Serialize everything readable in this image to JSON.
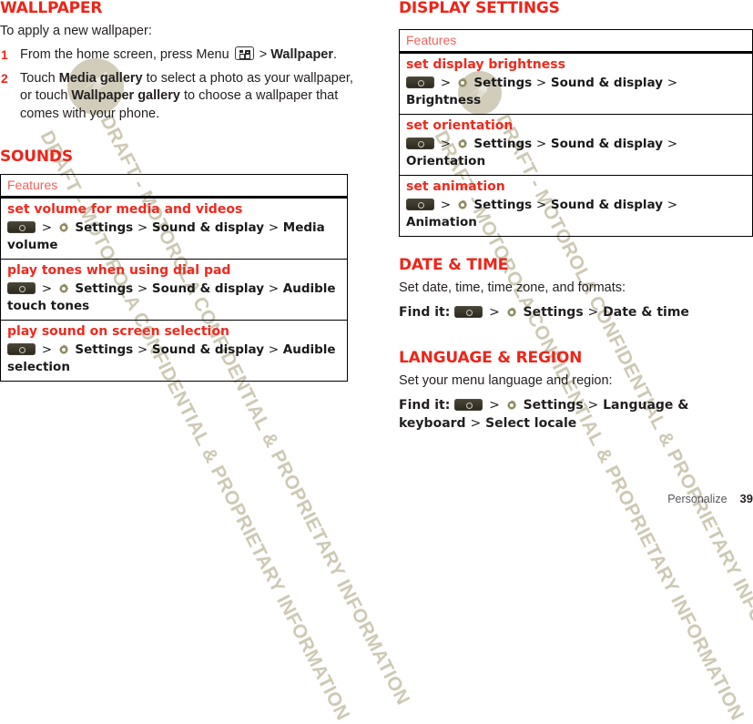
{
  "document": {
    "watermark_text": "DRAFT - MOTOROLA CONFIDENTIAL & PROPRIETARY INFORMATION",
    "colors": {
      "heading_red": "#ec2519",
      "feature_red": "#ee2a1e",
      "table_header_red": "#f2615a",
      "body_text": "#231f20",
      "watermark": "#c9c5ae",
      "gear_icon": "#8d8a5e"
    }
  },
  "left_column": {
    "wallpaper": {
      "heading": "WALLPAPER",
      "intro": "To apply a new wallpaper:",
      "steps": [
        {
          "num": "1",
          "part1": "From the home screen, press Menu",
          "icon": "menu-key-icon",
          "part2": ">",
          "bold_tail": "Wallpaper",
          "tail_punct": "."
        },
        {
          "num": "2",
          "pre": "Touch ",
          "bold1": "Media gallery",
          "mid": " to select a photo as your wallpaper, or touch ",
          "bold2": "Wallpaper gallery",
          "post": " to choose a wallpaper that comes with your phone."
        }
      ]
    },
    "sounds": {
      "heading": "SOUNDS",
      "table": {
        "header": "Features",
        "rows": [
          {
            "title": "set volume for media and videos",
            "path": [
              "Settings",
              "Sound & display",
              "Media volume"
            ]
          },
          {
            "title": "play tones when using dial pad",
            "path": [
              "Settings",
              "Sound & display",
              "Audible touch tones"
            ]
          },
          {
            "title": "play sound on screen selection",
            "path": [
              "Settings",
              "Sound & display",
              "Audible selection"
            ]
          }
        ]
      }
    }
  },
  "right_column": {
    "display_settings": {
      "heading": "DISPLAY SETTINGS",
      "table": {
        "header": "Features",
        "rows": [
          {
            "title": "set display brightness",
            "path": [
              "Settings",
              "Sound & display",
              "Brightness"
            ]
          },
          {
            "title": "set orientation",
            "path": [
              "Settings",
              "Sound & display",
              "Orientation"
            ]
          },
          {
            "title": "set animation",
            "path": [
              "Settings",
              "Sound & display",
              "Animation"
            ]
          }
        ]
      }
    },
    "date_time": {
      "heading": "DATE & TIME",
      "intro": "Set date, time, time zone, and formats:",
      "find_it_label": "Find it:",
      "path": [
        "Settings",
        "Date & time"
      ]
    },
    "language_region": {
      "heading": "LANGUAGE & REGION",
      "intro": "Set your menu language and region:",
      "find_it_label": "Find it:",
      "path": [
        "Settings",
        "Language & keyboard",
        "Select locale"
      ]
    }
  },
  "footer": {
    "chapter": "Personalize",
    "page_number": "39"
  }
}
